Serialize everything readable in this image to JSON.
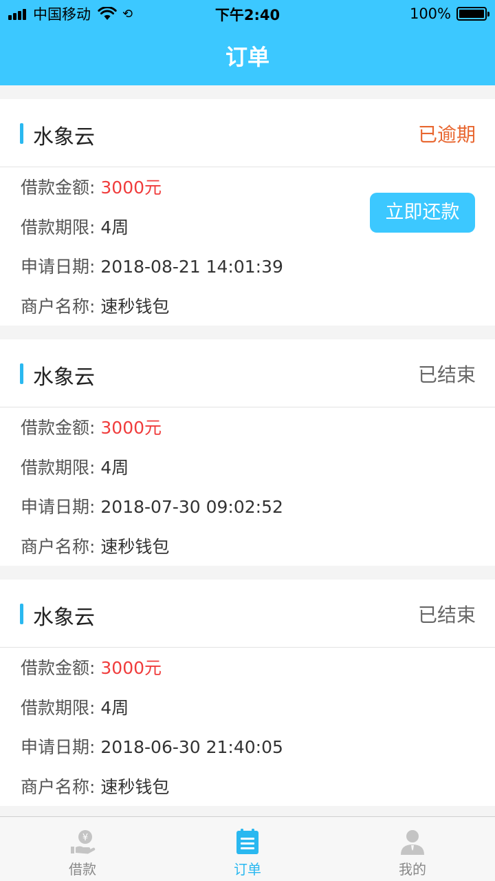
{
  "status_bar": {
    "carrier": "中国移动",
    "time": "下午2:40",
    "battery": "100%",
    "battery_level": 1.0
  },
  "header": {
    "title": "订单"
  },
  "labels": {
    "amount": "借款金额:",
    "term": "借款期限:",
    "date": "申请日期:",
    "merchant": "商户名称:"
  },
  "orders": [
    {
      "platform": "水象云",
      "status": "已逾期",
      "amount": "3000元",
      "term": "4周",
      "date": "2018-08-21 14:01:39",
      "merchant": "速秒钱包",
      "action_label": "立即还款"
    },
    {
      "platform": "水象云",
      "status": "已结束",
      "amount": "3000元",
      "term": "4周",
      "date": "2018-07-30 09:02:52",
      "merchant": "速秒钱包"
    },
    {
      "platform": "水象云",
      "status": "已结束",
      "amount": "3000元",
      "term": "4周",
      "date": "2018-06-30 21:40:05",
      "merchant": "速秒钱包"
    }
  ],
  "tab_bar": {
    "tabs": [
      {
        "label": "借款",
        "icon": "loan-icon",
        "active": false
      },
      {
        "label": "订单",
        "icon": "order-icon",
        "active": true
      },
      {
        "label": "我的",
        "icon": "profile-icon",
        "active": false
      }
    ]
  },
  "colors": {
    "brand": "#3cc8ff",
    "overdue": "#e8662f",
    "amount": "#f03c3c",
    "tab_active": "#2ab8f0",
    "tab_inactive": "#c4c4c4"
  }
}
